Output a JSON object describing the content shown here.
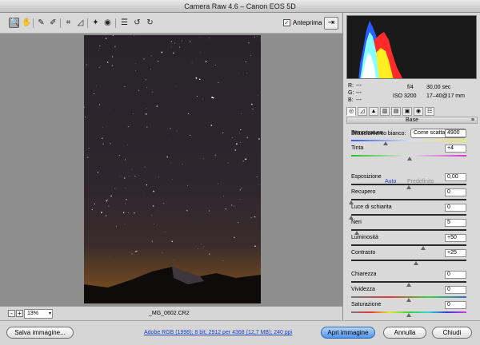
{
  "window": {
    "title": "Camera Raw 4.6  –  Canon EOS 5D"
  },
  "toolbar": {
    "tools": [
      {
        "name": "zoom-icon",
        "glyph": "🔍"
      },
      {
        "name": "hand-icon",
        "glyph": "✋"
      },
      {
        "name": "white-balance-icon",
        "glyph": "✎"
      },
      {
        "name": "color-sampler-icon",
        "glyph": "✐"
      },
      {
        "name": "crop-icon",
        "glyph": "⌗"
      },
      {
        "name": "straighten-icon",
        "glyph": "◿"
      },
      {
        "name": "retouch-icon",
        "glyph": "✦"
      },
      {
        "name": "red-eye-icon",
        "glyph": "◉"
      },
      {
        "name": "preferences-icon",
        "glyph": "☰"
      },
      {
        "name": "rotate-left-icon",
        "glyph": "↺"
      },
      {
        "name": "rotate-right-icon",
        "glyph": "↻"
      }
    ],
    "preview_checked": "✓",
    "preview_label": "Anteprima",
    "fullscreen_glyph": "⇥"
  },
  "status": {
    "zoom": "13%",
    "filename": "_MG_0602.CR2",
    "zoom_out": "-",
    "zoom_in": "+"
  },
  "info": {
    "r_label": "R:",
    "g_label": "G:",
    "b_label": "B:",
    "r": "---",
    "g": "---",
    "b": "---",
    "aperture": "f/4",
    "shutter": "30,00 sec",
    "iso": "ISO 3200",
    "lens": "17–40@17 mm"
  },
  "panel": {
    "title": "Base",
    "wb_label": "Bilanciamento bianco:",
    "wb_value": "Come scattato",
    "auto": "Auto",
    "default": "Predefinito",
    "sliders": [
      {
        "key": "temperatura",
        "label": "Temperatura",
        "value": "4900",
        "pos": 0.3
      },
      {
        "key": "tinta",
        "label": "Tinta",
        "value": "+4",
        "pos": 0.51
      },
      {
        "key": "esposizione",
        "label": "Esposizione",
        "value": "0,00",
        "pos": 0.5
      },
      {
        "key": "recupero",
        "label": "Recupero",
        "value": "0",
        "pos": 0.0
      },
      {
        "key": "luce-schiarita",
        "label": "Luce di schiarita",
        "value": "0",
        "pos": 0.0
      },
      {
        "key": "neri",
        "label": "Neri",
        "value": "5",
        "pos": 0.05
      },
      {
        "key": "luminosita",
        "label": "Luminosità",
        "value": "+50",
        "pos": 0.625
      },
      {
        "key": "contrasto",
        "label": "Contrasto",
        "value": "+25",
        "pos": 0.5625
      },
      {
        "key": "chiarezza",
        "label": "Chiarezza",
        "value": "0",
        "pos": 0.5
      },
      {
        "key": "vividezza",
        "label": "Vividezza",
        "value": "0",
        "pos": 0.5
      },
      {
        "key": "saturazione",
        "label": "Saturazione",
        "value": "0",
        "pos": 0.5
      }
    ]
  },
  "bottom": {
    "save": "Salva immagine...",
    "workflow": "Adobe RGB (1998); 8 bit; 2912 per 4368 (12,7 MB); 240 ppi",
    "open": "Apri immagine",
    "cancel": "Annulla",
    "done": "Chiudi"
  },
  "colors": {
    "accent": "#3b78d8",
    "link": "#1a3fc9"
  }
}
